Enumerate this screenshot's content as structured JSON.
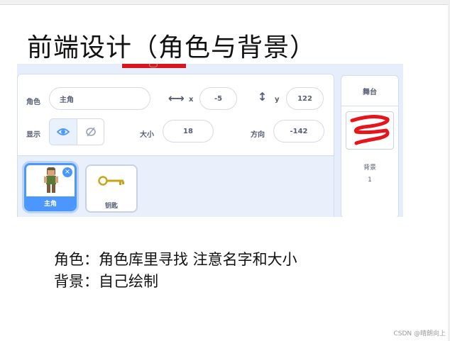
{
  "slide": {
    "title": "前端设计（角色与背景）",
    "line1": "角色：角色库里寻找 注意名字和大小",
    "line2": "背景：自己绘制",
    "credit": "CSDN @晴朗向上"
  },
  "sprite_info": {
    "sprite_label": "角色",
    "sprite_name": "主角",
    "x_label": "x",
    "x_value": "-5",
    "y_label": "y",
    "y_value": "122",
    "show_label": "显示",
    "size_label": "大小",
    "size_value": "18",
    "direction_label": "方向",
    "direction_value": "-142"
  },
  "sprites": [
    {
      "name": "主角",
      "selected": true
    },
    {
      "name": "钥匙",
      "selected": false
    }
  ],
  "stage": {
    "header": "舞台",
    "backdrops_label": "背景",
    "backdrops_count": "1"
  },
  "colors": {
    "accent": "#4c97ff",
    "panel_bg": "#e9f0fb",
    "red_mark": "#e8141c"
  }
}
